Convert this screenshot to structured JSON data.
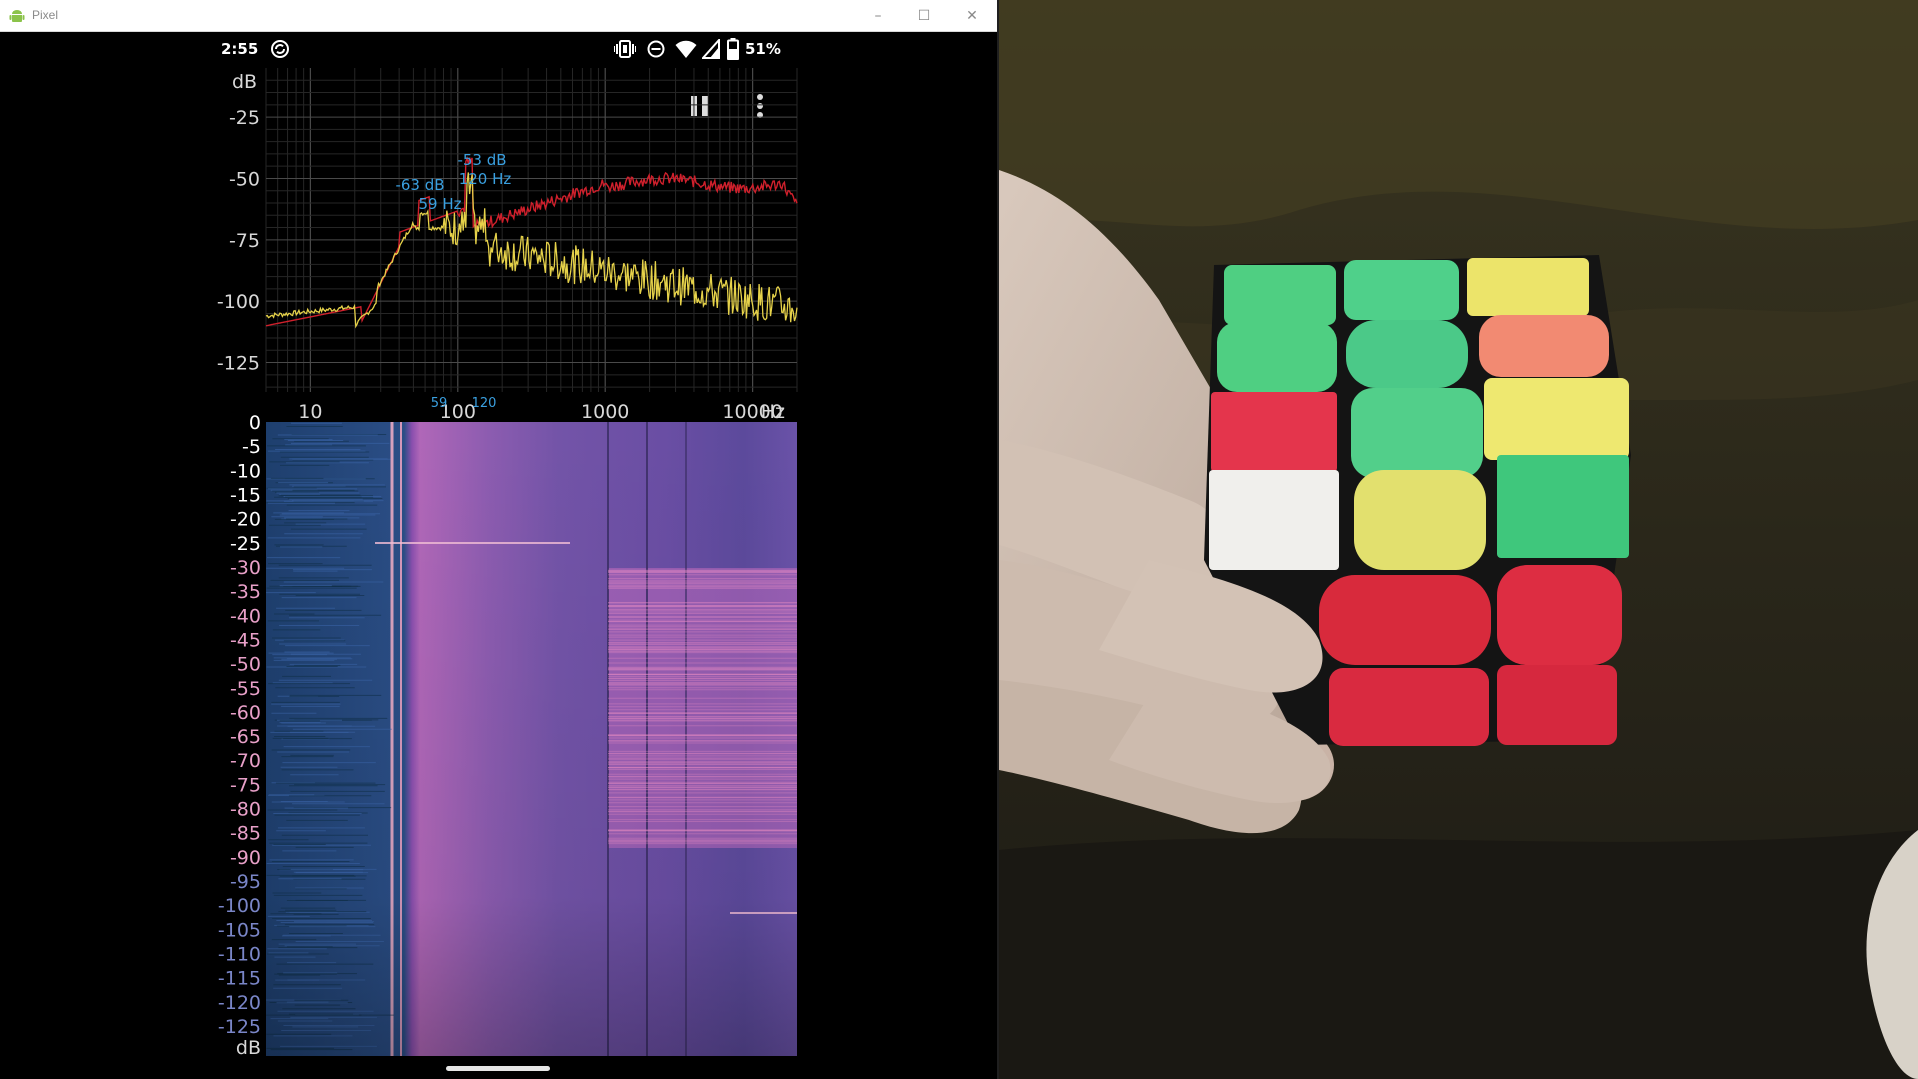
{
  "window": {
    "title": "Pixel",
    "minimize_glyph": "–",
    "maximize_glyph": "☐",
    "close_glyph": "✕"
  },
  "status_bar": {
    "time": "2:55",
    "battery_percent": "51%",
    "icons": [
      "sync-icon",
      "vibrate-icon",
      "do-not-disturb-icon",
      "wifi-icon",
      "cell-signal-icon",
      "battery-icon"
    ]
  },
  "analyzer": {
    "controls": {
      "pause_icon": "pause-icon",
      "menu_icon": "more-vert-icon"
    },
    "spectrum": {
      "y_unit": "dB",
      "y_ticks": [
        "-25",
        "-50",
        "-75",
        "-100",
        "-125"
      ],
      "x_ticks": [
        "10",
        "100",
        "1000",
        "10000"
      ],
      "x_unit": "Hz",
      "peak_markers": [
        "59",
        "120"
      ],
      "peak_labels": [
        {
          "db": "-63 dB",
          "hz": "59 Hz"
        },
        {
          "db": "-53 dB",
          "hz": "120 Hz"
        }
      ],
      "colors": {
        "peak_hold": "#d0202c",
        "current": "#e6d24a",
        "grid": "#3a3a3a",
        "label": "#3aa0e0"
      }
    },
    "spectrogram": {
      "y_ticks": [
        "0",
        "-5",
        "-10",
        "-15",
        "-20",
        "-25",
        "-30",
        "-35",
        "-40",
        "-45",
        "-50",
        "-55",
        "-60",
        "-65",
        "-70",
        "-75",
        "-80",
        "-85",
        "-90",
        "-95",
        "-100",
        "-105",
        "-110",
        "-115",
        "-120",
        "-125"
      ],
      "y_unit": "dB",
      "colors": {
        "low": "#2a4a8a",
        "mid": "#8a4aa0",
        "high": "#e07ab0"
      }
    }
  },
  "camera": {
    "subject_colors": [
      "#4fd08a",
      "#e8e06a",
      "#f07a6a",
      "#e4334a",
      "#f2f2f2"
    ]
  }
}
